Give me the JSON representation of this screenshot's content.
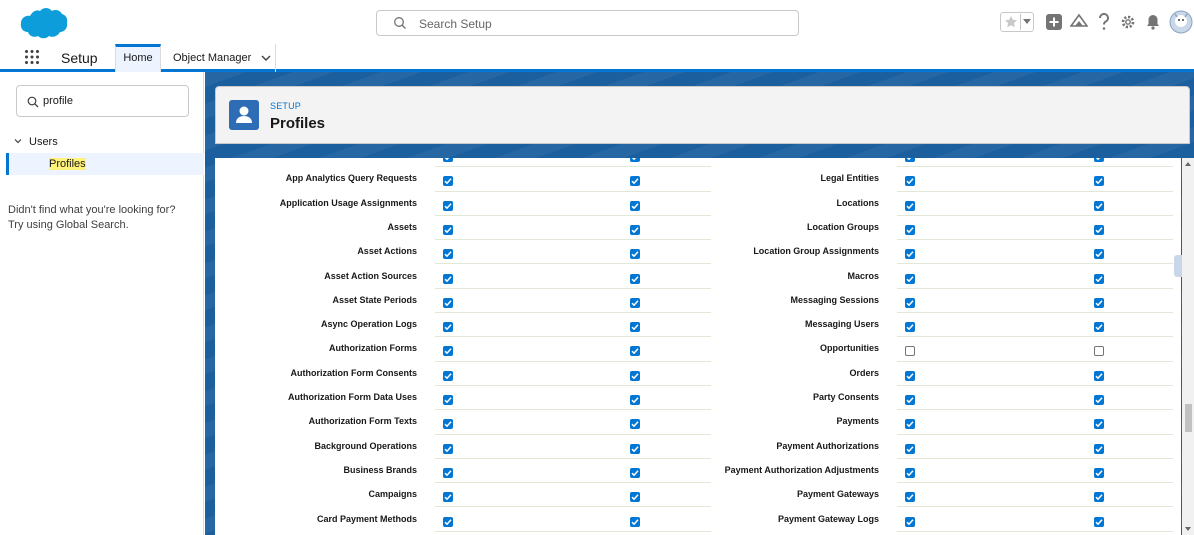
{
  "header": {
    "search_placeholder": "Search Setup"
  },
  "context": {
    "app_name": "Setup",
    "tabs": [
      {
        "label": "Home"
      },
      {
        "label": "Object Manager"
      }
    ]
  },
  "sidebar": {
    "quickfind_value": "profile",
    "group_label": "Users",
    "item_label": "Profiles",
    "not_found_line1": "Didn't find what you're looking for?",
    "not_found_line2": "Try using Global Search."
  },
  "page": {
    "breadcrumb": "SETUP",
    "title": "Profiles"
  },
  "permissions": {
    "rows": [
      {
        "left_label": "",
        "left_read": true,
        "left_create": true,
        "right_label": "",
        "right_read": true,
        "right_create": true
      },
      {
        "left_label": "App Analytics Query Requests",
        "left_read": true,
        "left_create": true,
        "right_label": "Legal Entities",
        "right_read": true,
        "right_create": true
      },
      {
        "left_label": "Application Usage Assignments",
        "left_read": true,
        "left_create": true,
        "right_label": "Locations",
        "right_read": true,
        "right_create": true
      },
      {
        "left_label": "Assets",
        "left_read": true,
        "left_create": true,
        "right_label": "Location Groups",
        "right_read": true,
        "right_create": true
      },
      {
        "left_label": "Asset Actions",
        "left_read": true,
        "left_create": true,
        "right_label": "Location Group Assignments",
        "right_read": true,
        "right_create": true
      },
      {
        "left_label": "Asset Action Sources",
        "left_read": true,
        "left_create": true,
        "right_label": "Macros",
        "right_read": true,
        "right_create": true
      },
      {
        "left_label": "Asset State Periods",
        "left_read": true,
        "left_create": true,
        "right_label": "Messaging Sessions",
        "right_read": true,
        "right_create": true
      },
      {
        "left_label": "Async Operation Logs",
        "left_read": true,
        "left_create": true,
        "right_label": "Messaging Users",
        "right_read": true,
        "right_create": true
      },
      {
        "left_label": "Authorization Forms",
        "left_read": true,
        "left_create": true,
        "right_label": "Opportunities",
        "right_read": false,
        "right_create": false
      },
      {
        "left_label": "Authorization Form Consents",
        "left_read": true,
        "left_create": true,
        "right_label": "Orders",
        "right_read": true,
        "right_create": true
      },
      {
        "left_label": "Authorization Form Data Uses",
        "left_read": true,
        "left_create": true,
        "right_label": "Party Consents",
        "right_read": true,
        "right_create": true
      },
      {
        "left_label": "Authorization Form Texts",
        "left_read": true,
        "left_create": true,
        "right_label": "Payments",
        "right_read": true,
        "right_create": true
      },
      {
        "left_label": "Background Operations",
        "left_read": true,
        "left_create": true,
        "right_label": "Payment Authorizations",
        "right_read": true,
        "right_create": true
      },
      {
        "left_label": "Business Brands",
        "left_read": true,
        "left_create": true,
        "right_label": "Payment Authorization Adjustments",
        "right_read": true,
        "right_create": true
      },
      {
        "left_label": "Campaigns",
        "left_read": true,
        "left_create": true,
        "right_label": "Payment Gateways",
        "right_read": true,
        "right_create": true
      },
      {
        "left_label": "Card Payment Methods",
        "left_read": true,
        "left_create": true,
        "right_label": "Payment Gateway Logs",
        "right_read": true,
        "right_create": true
      }
    ]
  },
  "colors": {
    "brand": "#0176d3",
    "banner": "#1b5f9e",
    "highlight": "#fff37a"
  },
  "icons": {
    "logo": "salesforce-cloud-logo",
    "search": "search-icon",
    "favorites": "star-icon",
    "favorites_menu": "chevron-down-icon",
    "global_actions": "plus-icon",
    "trailhead": "trailhead-icon",
    "help": "question-icon",
    "setup": "gear-icon",
    "notifications": "bell-icon",
    "avatar": "avatar-icon"
  }
}
